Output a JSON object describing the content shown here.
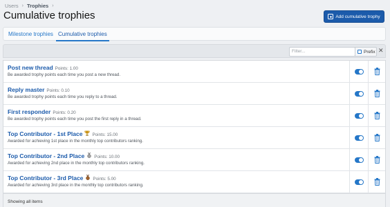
{
  "breadcrumb": {
    "items": [
      "Users",
      "Trophies"
    ]
  },
  "page": {
    "title": "Cumulative trophies"
  },
  "toolbar": {
    "add_label": "Add cumulative trophy"
  },
  "tabs": [
    {
      "label": "Milestone trophies",
      "active": false
    },
    {
      "label": "Cumulative trophies",
      "active": true
    }
  ],
  "filter": {
    "placeholder": "Filter...",
    "prefix_label": "Prefix"
  },
  "rows": [
    {
      "title": "Post new thread",
      "points": "Points: 1.00",
      "desc": "Be awarded trophy points each time you post a new thread.",
      "icon": ""
    },
    {
      "title": "Reply master",
      "points": "Points: 0.10",
      "desc": "Be awarded trophy points each time you reply to a thread.",
      "icon": ""
    },
    {
      "title": "First responder",
      "points": "Points: 0.20",
      "desc": "Be awarded trophy points each time you post the first reply in a thread.",
      "icon": ""
    },
    {
      "title": "Top Contributor - 1st Place",
      "points": "Points: 15.00",
      "desc": "Awarded for achieving 1st place in the monthly top contributors ranking.",
      "icon": "gold-trophy-icon"
    },
    {
      "title": "Top Contributor - 2nd Place",
      "points": "Points: 10.00",
      "desc": "Awarded for achieving 2nd place in the monthly top contributors ranking.",
      "icon": "silver-medal-icon"
    },
    {
      "title": "Top Contributor - 3rd Place",
      "points": "Points: 5.00",
      "desc": "Awarded for achieving 3rd place in the monthly top contributors ranking.",
      "icon": "bronze-medal-icon"
    }
  ],
  "footer": {
    "label": "Showing all items"
  },
  "colors": {
    "accent": "#2577c8",
    "button": "#1c5bab",
    "gold": "#c9941a",
    "silver": "#8c8c8c",
    "bronze": "#a0622d"
  }
}
